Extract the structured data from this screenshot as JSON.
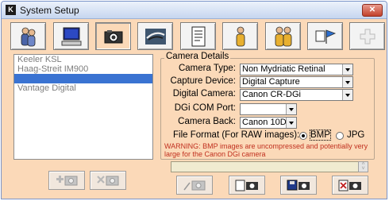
{
  "window": {
    "title": "System Setup",
    "app_icon_glyph": "K",
    "close_glyph": "✕"
  },
  "toolbar": {
    "buttons": [
      {
        "name": "users-icon",
        "active": false
      },
      {
        "name": "computer-icon",
        "active": false
      },
      {
        "name": "camera-icon",
        "active": true
      },
      {
        "name": "eye-icon",
        "active": false
      },
      {
        "name": "document-icon",
        "active": false
      },
      {
        "name": "person-icon",
        "active": false
      },
      {
        "name": "group-icon",
        "active": false
      },
      {
        "name": "flag-icon",
        "active": false
      },
      {
        "name": "plus-icon",
        "active": false
      }
    ]
  },
  "camera_list": {
    "items": [
      {
        "label": "Keeler KSL",
        "selected": false
      },
      {
        "label": "Haag-Streit IM900",
        "selected": false
      },
      {
        "label": "",
        "selected": true
      },
      {
        "label": "Vantage Digital",
        "selected": false
      }
    ]
  },
  "camera_details": {
    "group_title": "Camera Details",
    "camera_type": {
      "label": "Camera Type:",
      "value": "Non Mydriatic Retinal"
    },
    "capture_device": {
      "label": "Capture Device:",
      "value": "Digital Capture"
    },
    "digital_camera": {
      "label": "Digital Camera:",
      "value": "Canon CR-DGi"
    },
    "com_port": {
      "label": "DGi COM Port:",
      "value": ""
    },
    "camera_back": {
      "label": "Camera Back:",
      "value": "Canon 10D"
    },
    "file_format": {
      "label": "File Format (For RAW images):",
      "options": [
        "BMP",
        "JPG"
      ],
      "selected": "BMP"
    },
    "warning": "WARNING: BMP images are uncompressed and potentially very large for the Canon DGi camera"
  },
  "colors": {
    "window_bg": "#fbd9b8",
    "selection": "#3a73d2",
    "warning": "#c0301f"
  }
}
